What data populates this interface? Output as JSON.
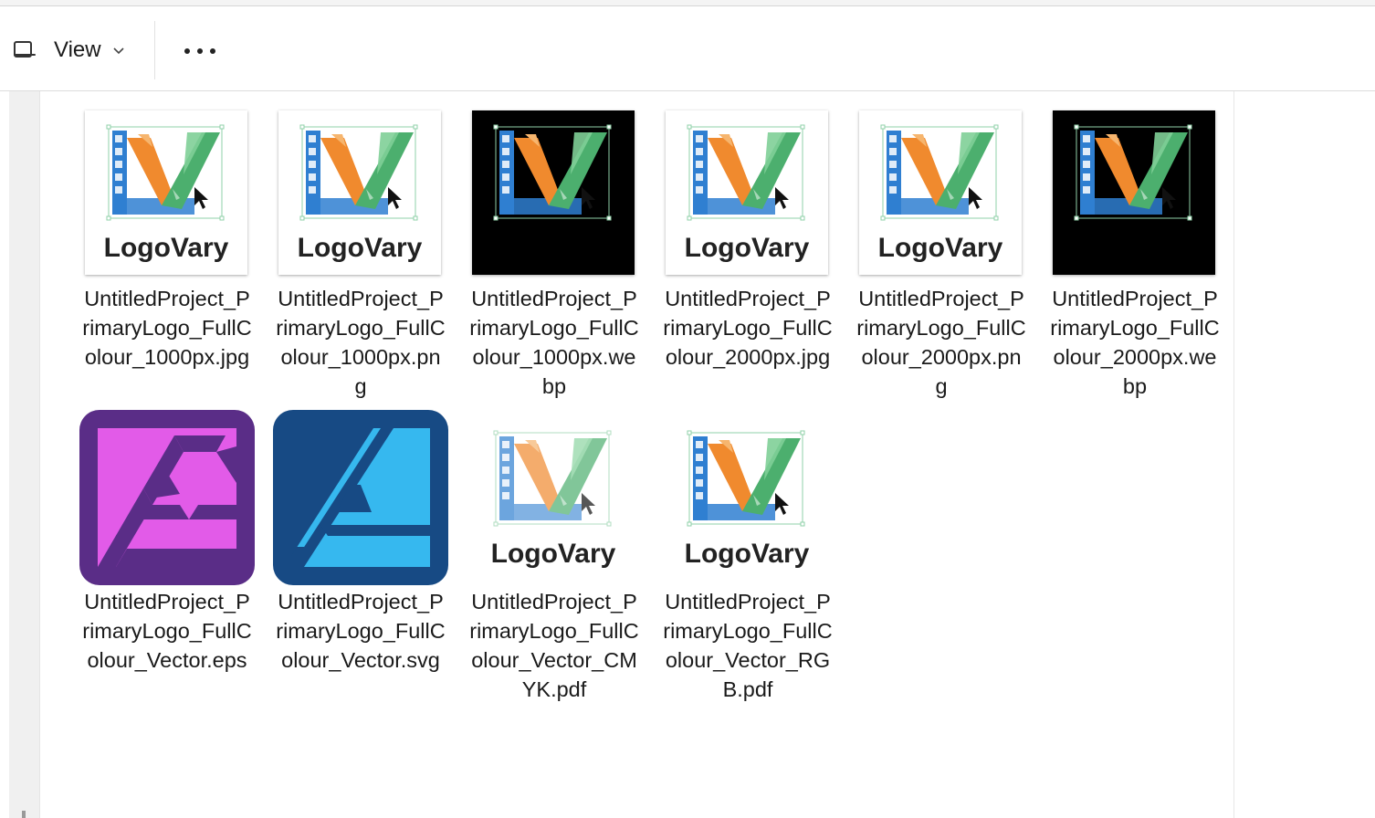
{
  "toolbar": {
    "view_label": "View",
    "view_icon": "view-layout-icon",
    "chevron_icon": "chevron-down-icon",
    "more_icon": "more-options-icon"
  },
  "logo_wordmark": "LogoVary",
  "colors": {
    "logo_orange": "#f08a2e",
    "logo_green": "#4caf6e",
    "logo_blue": "#2f7fd1",
    "eps_purple_bg": "#5a2d87",
    "eps_pink": "#e25be8",
    "svg_blue_bg": "#174a84",
    "svg_cyan": "#36b8ef"
  },
  "files": [
    {
      "name": "UntitledProject_PrimaryLogo_FullColour_1000px.jpg",
      "lines": [
        "UntitledProject_P",
        "rimaryLogo_FullC",
        "olour_1000px.jpg"
      ],
      "thumb": "logo-white"
    },
    {
      "name": "UntitledProject_PrimaryLogo_FullColour_1000px.png",
      "lines": [
        "UntitledProject_P",
        "rimaryLogo_FullC",
        "olour_1000px.pn",
        "g"
      ],
      "thumb": "logo-white"
    },
    {
      "name": "UntitledProject_PrimaryLogo_FullColour_1000px.webp",
      "lines": [
        "UntitledProject_P",
        "rimaryLogo_FullC",
        "olour_1000px.we",
        "bp"
      ],
      "thumb": "logo-black"
    },
    {
      "name": "UntitledProject_PrimaryLogo_FullColour_2000px.jpg",
      "lines": [
        "UntitledProject_P",
        "rimaryLogo_FullC",
        "olour_2000px.jpg"
      ],
      "thumb": "logo-white"
    },
    {
      "name": "UntitledProject_PrimaryLogo_FullColour_2000px.png",
      "lines": [
        "UntitledProject_P",
        "rimaryLogo_FullC",
        "olour_2000px.pn",
        "g"
      ],
      "thumb": "logo-white"
    },
    {
      "name": "UntitledProject_PrimaryLogo_FullColour_2000px.webp",
      "lines": [
        "UntitledProject_P",
        "rimaryLogo_FullC",
        "olour_2000px.we",
        "bp"
      ],
      "thumb": "logo-black"
    },
    {
      "name": "UntitledProject_PrimaryLogo_FullColour_Vector.eps",
      "lines": [
        "UntitledProject_P",
        "rimaryLogo_FullC",
        "olour_Vector.eps"
      ],
      "thumb": "affinity-photo-icon"
    },
    {
      "name": "UntitledProject_PrimaryLogo_FullColour_Vector.svg",
      "lines": [
        "UntitledProject_P",
        "rimaryLogo_FullC",
        "olour_Vector.svg"
      ],
      "thumb": "affinity-designer-icon"
    },
    {
      "name": "UntitledProject_PrimaryLogo_FullColour_Vector_CMYK.pdf",
      "lines": [
        "UntitledProject_P",
        "rimaryLogo_FullC",
        "olour_Vector_CM",
        "YK.pdf"
      ],
      "thumb": "logo-cmyk"
    },
    {
      "name": "UntitledProject_PrimaryLogo_FullColour_Vector_RGB.pdf",
      "lines": [
        "UntitledProject_P",
        "rimaryLogo_FullC",
        "olour_Vector_RG",
        "B.pdf"
      ],
      "thumb": "logo-rgb"
    }
  ]
}
